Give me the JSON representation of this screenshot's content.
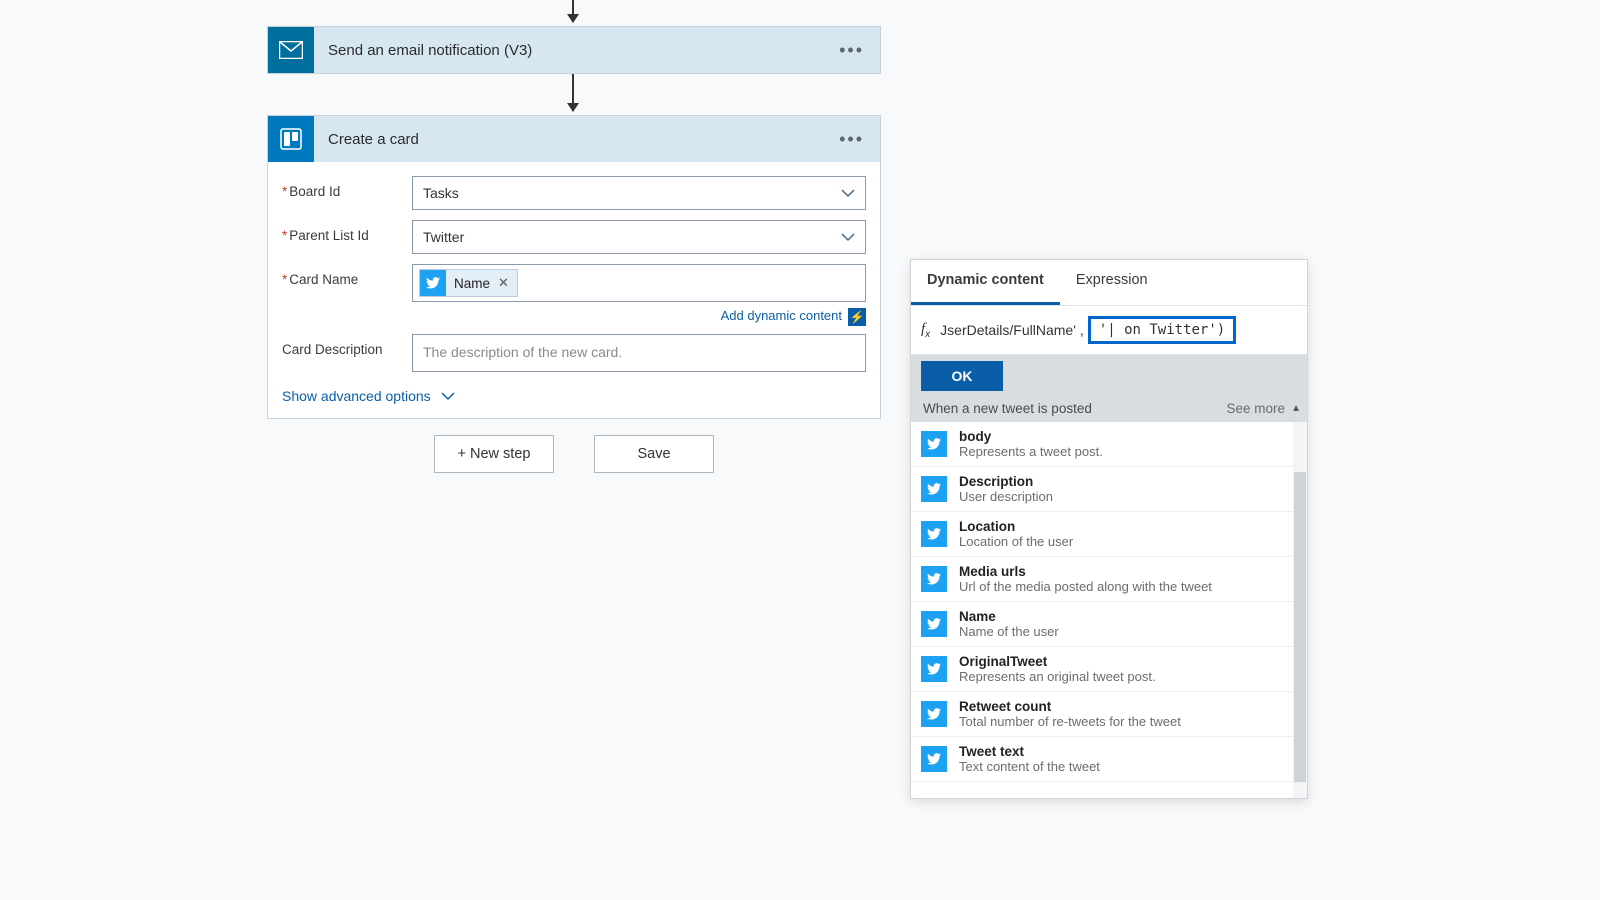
{
  "steps": {
    "email": {
      "title": "Send an email notification (V3)"
    },
    "card": {
      "title": "Create a card",
      "fields": {
        "board": {
          "label": "Board Id",
          "value": "Tasks"
        },
        "list": {
          "label": "Parent List Id",
          "value": "Twitter"
        },
        "name": {
          "label": "Card Name",
          "token": "Name"
        },
        "desc": {
          "label": "Card Description",
          "placeholder": "The description of the new card."
        }
      },
      "add_dynamic": "Add dynamic content",
      "advanced": "Show advanced options"
    }
  },
  "buttons": {
    "new_step": "+ New step",
    "save": "Save"
  },
  "popup": {
    "tabs": {
      "dynamic": "Dynamic content",
      "expression": "Expression"
    },
    "fx_left": "JserDetails/FullName'",
    "fx_sep": ",",
    "fx_box": "'| on Twitter')",
    "ok": "OK",
    "section_title": "When a new tweet is posted",
    "see_more": "See more",
    "items": [
      {
        "title": "body",
        "desc": "Represents a tweet post."
      },
      {
        "title": "Description",
        "desc": "User description"
      },
      {
        "title": "Location",
        "desc": "Location of the user"
      },
      {
        "title": "Media urls",
        "desc": "Url of the media posted along with the tweet"
      },
      {
        "title": "Name",
        "desc": "Name of the user"
      },
      {
        "title": "OriginalTweet",
        "desc": "Represents an original tweet post."
      },
      {
        "title": "Retweet count",
        "desc": "Total number of re-tweets for the tweet"
      },
      {
        "title": "Tweet text",
        "desc": "Text content of the tweet"
      }
    ]
  }
}
